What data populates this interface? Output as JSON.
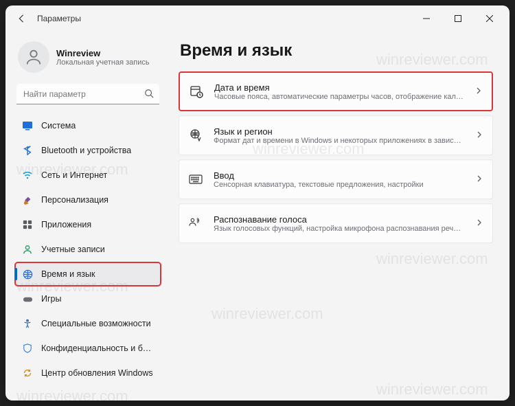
{
  "titlebar": {
    "app_name": "Параметры"
  },
  "user": {
    "name": "Winreview",
    "account": "Локальная учетная запись"
  },
  "search": {
    "placeholder": "Найти параметр"
  },
  "sidebar": {
    "items": [
      {
        "id": "system",
        "label": "Система"
      },
      {
        "id": "bluetooth",
        "label": "Bluetooth и устройства"
      },
      {
        "id": "network",
        "label": "Сеть и Интернет"
      },
      {
        "id": "personalization",
        "label": "Персонализация"
      },
      {
        "id": "apps",
        "label": "Приложения"
      },
      {
        "id": "accounts",
        "label": "Учетные записи"
      },
      {
        "id": "time",
        "label": "Время и язык"
      },
      {
        "id": "gaming",
        "label": "Игры"
      },
      {
        "id": "accessibility",
        "label": "Специальные возможности"
      },
      {
        "id": "privacy",
        "label": "Конфиденциальность и безопасность"
      },
      {
        "id": "update",
        "label": "Центр обновления Windows"
      }
    ]
  },
  "page": {
    "title": "Время и язык"
  },
  "cards": [
    {
      "id": "datetime",
      "title": "Дата и время",
      "sub": "Часовые пояса, автоматические параметры часов, отображение календаря"
    },
    {
      "id": "language",
      "title": "Язык и регион",
      "sub": "Формат дат и времени в Windows и некоторых приложениях в зависимости от региона"
    },
    {
      "id": "typing",
      "title": "Ввод",
      "sub": "Сенсорная клавиатура, текстовые предложения, настройки"
    },
    {
      "id": "speech",
      "title": "Распознавание голоса",
      "sub": "Язык голосовых функций, настройка микрофона распознавания речи, голоса"
    }
  ],
  "watermark": "winreviewer.com"
}
